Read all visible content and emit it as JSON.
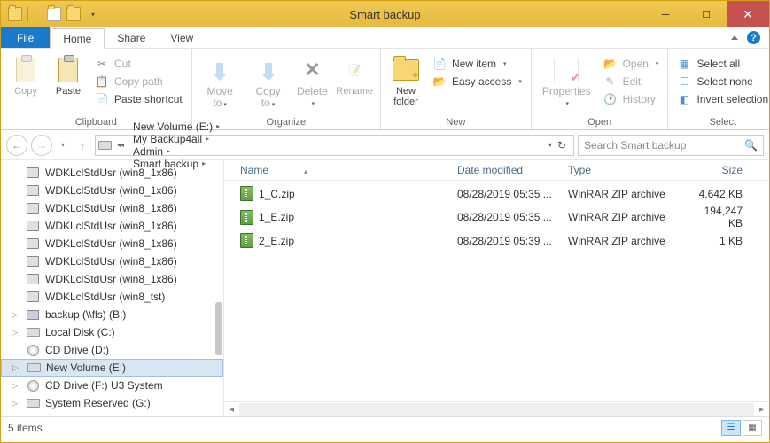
{
  "window": {
    "title": "Smart backup"
  },
  "tabs": {
    "file": "File",
    "home": "Home",
    "share": "Share",
    "view": "View"
  },
  "ribbon": {
    "clipboard": {
      "label": "Clipboard",
      "copy": "Copy",
      "paste": "Paste",
      "cut": "Cut",
      "copy_path": "Copy path",
      "paste_shortcut": "Paste shortcut"
    },
    "organize": {
      "label": "Organize",
      "move_to": "Move\nto",
      "copy_to": "Copy\nto",
      "delete": "Delete",
      "rename": "Rename"
    },
    "new": {
      "label": "New",
      "new_folder": "New\nfolder",
      "new_item": "New item",
      "easy_access": "Easy access"
    },
    "open": {
      "label": "Open",
      "properties": "Properties",
      "open": "Open",
      "edit": "Edit",
      "history": "History"
    },
    "select": {
      "label": "Select",
      "select_all": "Select all",
      "select_none": "Select none",
      "invert": "Invert selection"
    }
  },
  "breadcrumbs": [
    "New Volume (E:)",
    "My Backup4all",
    "Admin",
    "Smart backup"
  ],
  "search": {
    "placeholder": "Search Smart backup"
  },
  "tree_items": [
    {
      "label": "WDKLclStdUsr (win8_1x86)",
      "icon": "pc"
    },
    {
      "label": "WDKLclStdUsr (win8_1x86)",
      "icon": "pc"
    },
    {
      "label": "WDKLclStdUsr (win8_1x86)",
      "icon": "pc"
    },
    {
      "label": "WDKLclStdUsr (win8_1x86)",
      "icon": "pc"
    },
    {
      "label": "WDKLclStdUsr (win8_1x86)",
      "icon": "pc"
    },
    {
      "label": "WDKLclStdUsr (win8_1x86)",
      "icon": "pc"
    },
    {
      "label": "WDKLclStdUsr (win8_1x86)",
      "icon": "pc"
    },
    {
      "label": "WDKLclStdUsr (win8_tst)",
      "icon": "pc"
    },
    {
      "label": "backup (\\\\fls) (B:)",
      "icon": "net",
      "expandable": true
    },
    {
      "label": "Local Disk (C:)",
      "icon": "drive",
      "expandable": true
    },
    {
      "label": "CD Drive (D:)",
      "icon": "cd"
    },
    {
      "label": "New Volume (E:)",
      "icon": "drive",
      "expandable": true,
      "selected": true
    },
    {
      "label": "CD Drive (F:) U3 System",
      "icon": "cd",
      "expandable": true
    },
    {
      "label": "System Reserved (G:)",
      "icon": "drive",
      "expandable": true
    }
  ],
  "columns": {
    "name": "Name",
    "date": "Date modified",
    "type": "Type",
    "size": "Size"
  },
  "files": [
    {
      "name": "1_C.zip",
      "date": "08/28/2019 05:35 ...",
      "type": "WinRAR ZIP archive",
      "size": "4,642 KB"
    },
    {
      "name": "1_E.zip",
      "date": "08/28/2019 05:35 ...",
      "type": "WinRAR ZIP archive",
      "size": "194,247 KB"
    },
    {
      "name": "2_E.zip",
      "date": "08/28/2019 05:39 ...",
      "type": "WinRAR ZIP archive",
      "size": "1 KB"
    }
  ],
  "status": {
    "count": "5 items"
  }
}
